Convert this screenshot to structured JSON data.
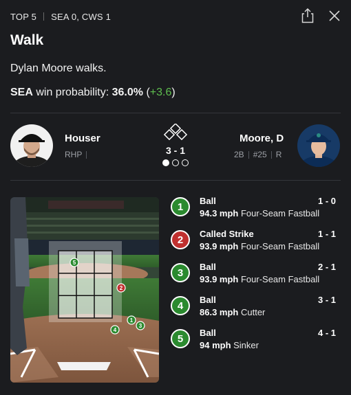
{
  "header": {
    "inning": "TOP 5",
    "score": "SEA 0, CWS 1",
    "share_icon": "share-icon",
    "close_icon": "close-icon"
  },
  "event": {
    "title": "Walk",
    "description": "Dylan Moore walks.",
    "win_prob": {
      "team": "SEA",
      "label": " win probability: ",
      "value": "36.0%",
      "open": " (",
      "delta": "+3.6",
      "close": ")"
    }
  },
  "matchup": {
    "pitcher": {
      "name": "Houser",
      "pos": "RHP"
    },
    "batter": {
      "name": "Moore, D",
      "pos": "2B",
      "number": "#25",
      "bats": "R"
    },
    "count": "3 - 1",
    "outs": 1
  },
  "pitches": [
    {
      "num": "1",
      "result": "Ball",
      "count": "1 - 0",
      "speed": "94.3 mph",
      "type": " Four-Seam Fastball",
      "color": "#2b8a2f"
    },
    {
      "num": "2",
      "result": "Called Strike",
      "count": "1 - 1",
      "speed": "93.9 mph",
      "type": " Four-Seam Fastball",
      "color": "#c0302f"
    },
    {
      "num": "3",
      "result": "Ball",
      "count": "2 - 1",
      "speed": "93.9 mph",
      "type": " Four-Seam Fastball",
      "color": "#2b8a2f"
    },
    {
      "num": "4",
      "result": "Ball",
      "count": "3 - 1",
      "speed": "86.3 mph",
      "type": " Cutter",
      "color": "#2b8a2f"
    },
    {
      "num": "5",
      "result": "Ball",
      "count": "4 - 1",
      "speed": "94 mph",
      "type": " Sinker",
      "color": "#2b8a2f"
    }
  ],
  "field_markers": [
    "5",
    "2",
    "1",
    "3",
    "4"
  ],
  "colors": {
    "ball": "#2b8a2f",
    "strike": "#c0302f",
    "positive_delta": "#5fbf4f",
    "background": "#1b1c1f"
  }
}
